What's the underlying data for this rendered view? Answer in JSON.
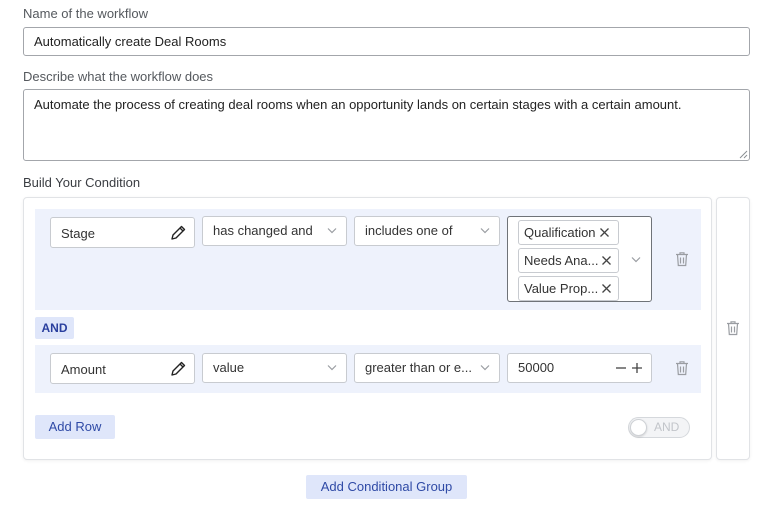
{
  "form": {
    "name_label": "Name of the workflow",
    "name_value": "Automatically create Deal Rooms",
    "description_label": "Describe what the workflow does",
    "description_value": "Automate the process of creating deal rooms when an opportunity lands on certain stages with a certain amount.",
    "condition_heading": "Build Your Condition"
  },
  "condition_group": {
    "rows": [
      {
        "field": "Stage",
        "change_type": "has changed and",
        "operator": "includes one of",
        "selected_values": [
          "Qualification",
          "Needs Analysis",
          "Value Proposition"
        ],
        "selected_values_display": [
          "Qualification",
          "Needs Ana...",
          "Value Prop..."
        ]
      },
      {
        "field": "Amount",
        "change_type": "value",
        "operator": "greater than or e...",
        "value": "50000"
      }
    ],
    "connector": "AND",
    "add_row_label": "Add Row",
    "logic_toggle_label": "AND",
    "logic_toggle_on": false
  },
  "add_group_label": "Add Conditional Group",
  "icons": {
    "field_edit": "pencil-icon",
    "dropdown": "chevron-down-icon",
    "remove_tag": "close-icon",
    "delete_row": "trash-icon",
    "delete_group": "trash-icon",
    "decrement": "minus-icon",
    "increment": "plus-icon"
  },
  "colors": {
    "accent_text": "#2f4aa6",
    "soft_button_bg": "#dfe6fa",
    "row_bg": "#eef2fc",
    "and_badge_text": "#2a3f9e"
  }
}
